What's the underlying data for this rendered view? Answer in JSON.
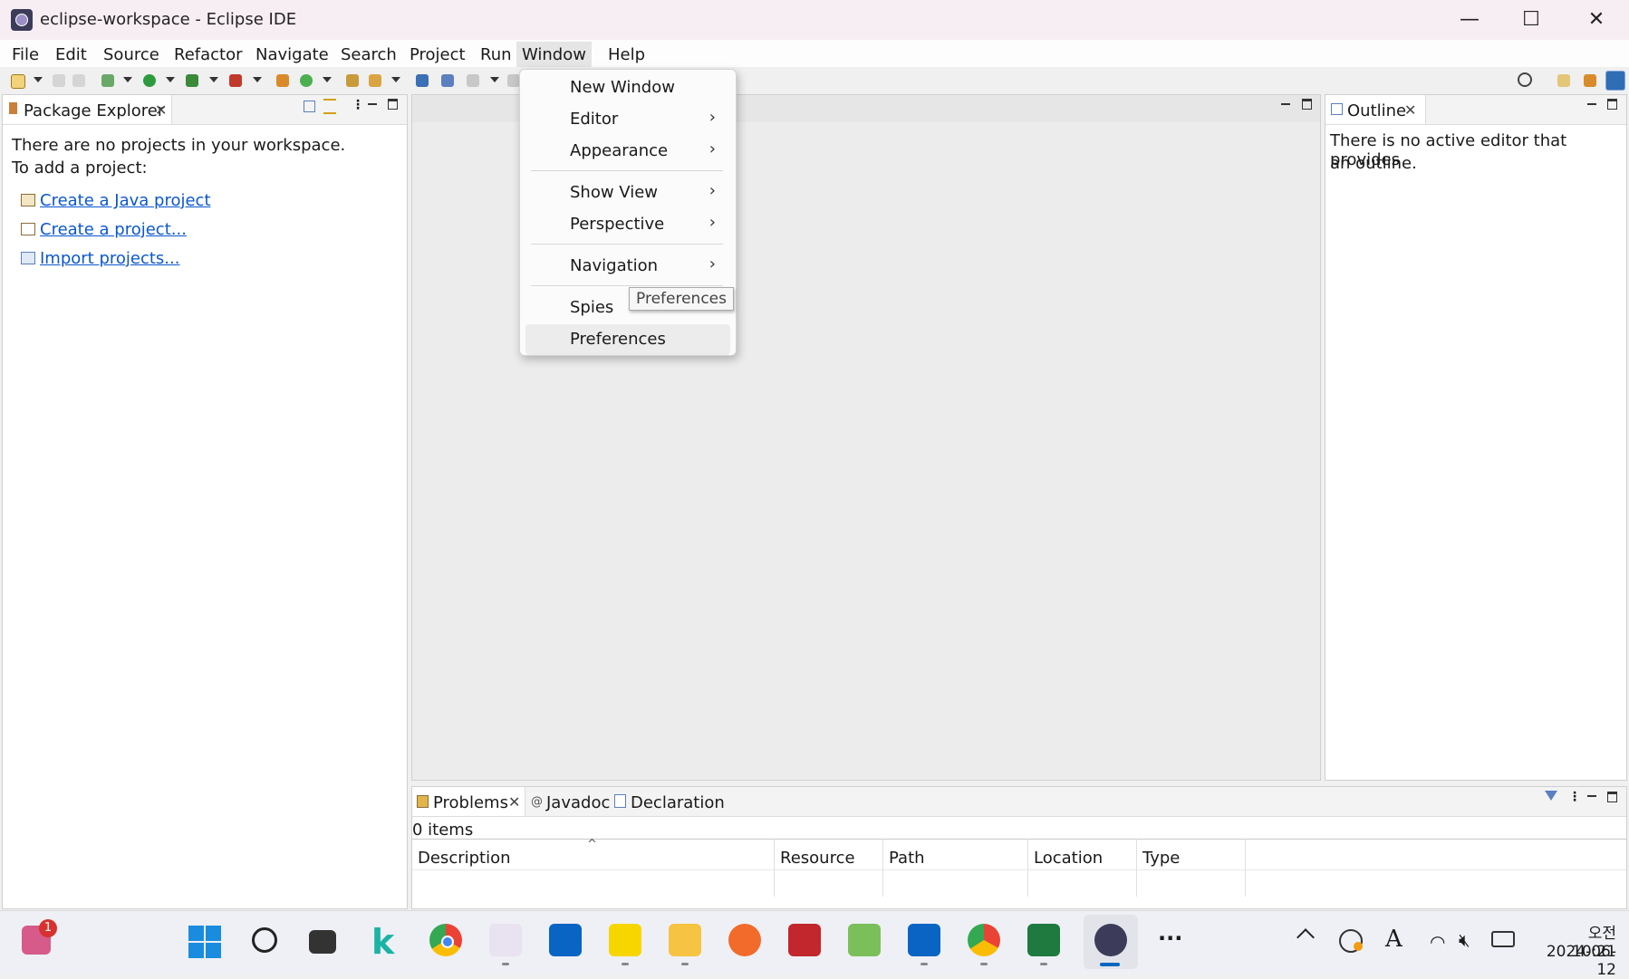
{
  "window": {
    "title": "eclipse-workspace - Eclipse IDE",
    "minimize": "—",
    "maximize": "☐",
    "close": "✕"
  },
  "menubar": [
    "File",
    "Edit",
    "Source",
    "Refactor",
    "Navigate",
    "Search",
    "Project",
    "Run",
    "Window",
    "Help"
  ],
  "package_explorer": {
    "tab": "Package Explorer",
    "line1": "There are no projects in your workspace.",
    "line2": "To add a project:",
    "links": [
      "Create a Java project",
      "Create a project...",
      "Import projects..."
    ]
  },
  "outline": {
    "tab": "Outline",
    "line1": "There is no active editor that provides",
    "line2": "an outline."
  },
  "window_menu": {
    "items": [
      {
        "label": "New Window",
        "submenu": false
      },
      {
        "label": "Editor",
        "submenu": true
      },
      {
        "label": "Appearance",
        "submenu": true
      },
      {
        "label": "Show View",
        "submenu": true
      },
      {
        "label": "Perspective",
        "submenu": true
      },
      {
        "label": "Navigation",
        "submenu": true
      },
      {
        "label": "Spies",
        "submenu": false
      },
      {
        "label": "Preferences",
        "submenu": false
      }
    ],
    "arrow": "›",
    "tooltip": "Preferences"
  },
  "bottom_panel": {
    "tabs": [
      "Problems",
      "Javadoc",
      "Declaration"
    ],
    "count": "0 items",
    "columns": [
      "Description",
      "Resource",
      "Path",
      "Location",
      "Type"
    ]
  },
  "taskbar": {
    "badge": "1",
    "more": "···",
    "time": "오전 10:21",
    "date": "2024-06-12",
    "font_label": "A"
  },
  "colors": {
    "link": "#0b57d0",
    "title_bg": "#f7eef4",
    "accent": "#0067c0"
  }
}
